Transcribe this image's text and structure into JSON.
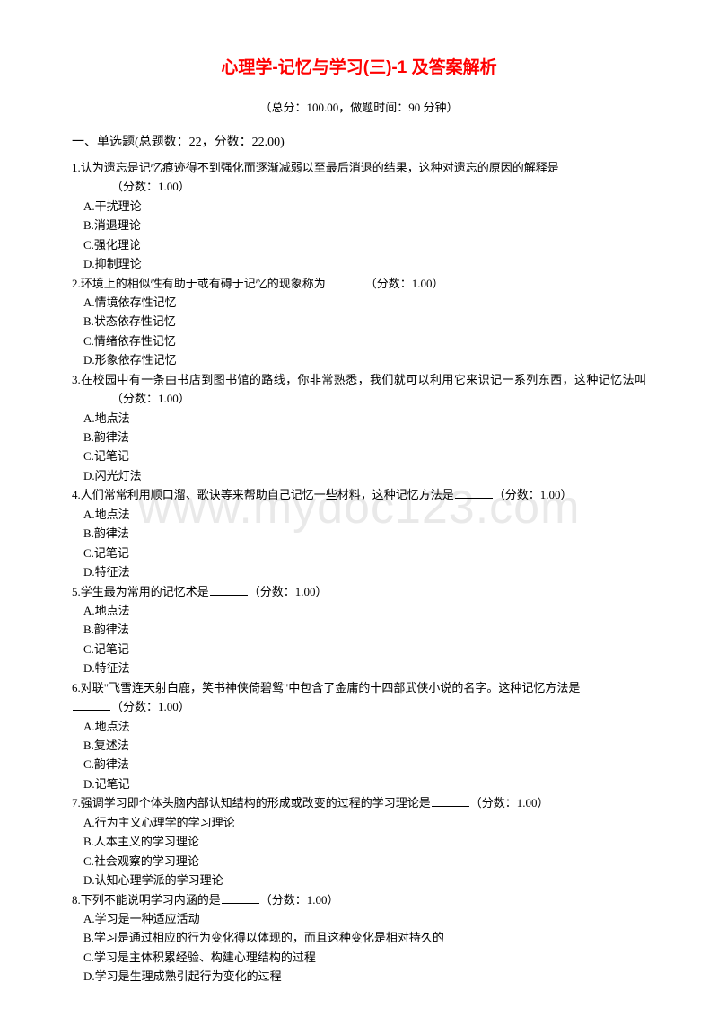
{
  "title": "心理学-记忆与学习(三)-1 及答案解析",
  "meta": "（总分：100.00，做题时间：90 分钟）",
  "section_heading": "一、单选题(总题数：22，分数：22.00)",
  "watermark": "www.mydoc123.com",
  "score_label": "（分数：1.00）",
  "questions": [
    {
      "num": "1.",
      "stem": "认为遗忘是记忆痕迹得不到强化而逐渐减弱以至最后消退的结果，这种对遗忘的原因的解释是",
      "tail_after_blank": true,
      "choices": [
        "A.干扰理论",
        "B.消退理论",
        "C.强化理论",
        "D.抑制理论"
      ]
    },
    {
      "num": "2.",
      "stem": "环境上的相似性有助于或有碍于记忆的现象称为",
      "tail_after_blank": false,
      "choices": [
        "A.情境依存性记忆",
        "B.状态依存性记忆",
        "C.情绪依存性记忆",
        "D.形象依存性记忆"
      ]
    },
    {
      "num": "3.",
      "stem": "在校园中有一条由书店到图书馆的路线，你非常熟悉，我们就可以利用它来识记一系列东西，这种记忆法叫",
      "tail_after_blank": false,
      "choices": [
        "A.地点法",
        "B.韵律法",
        "C.记笔记",
        "D.闪光灯法"
      ]
    },
    {
      "num": "4.",
      "stem": "人们常常利用顺口溜、歌诀等来帮助自己记忆一些材料，这种记忆方法是",
      "tail_after_blank": false,
      "choices": [
        "A.地点法",
        "B.韵律法",
        "C.记笔记",
        "D.特征法"
      ]
    },
    {
      "num": "5.",
      "stem": "学生最为常用的记忆术是",
      "tail_after_blank": false,
      "choices": [
        "A.地点法",
        "B.韵律法",
        "C.记笔记",
        "D.特征法"
      ]
    },
    {
      "num": "6.",
      "stem": "对联\"飞雪连天射白鹿，笑书神侠倚碧鸳\"中包含了金庸的十四部武侠小说的名字。这种记忆方法是",
      "tail_after_blank": true,
      "choices": [
        "A.地点法",
        "B.复述法",
        "C.韵律法",
        "D.记笔记"
      ]
    },
    {
      "num": "7.",
      "stem": "强调学习即个体头脑内部认知结构的形成或改变的过程的学习理论是",
      "tail_after_blank": false,
      "choices": [
        "A.行为主义心理学的学习理论",
        "B.人本主义的学习理论",
        "C.社会观察的学习理论",
        "D.认知心理学派的学习理论"
      ]
    },
    {
      "num": "8.",
      "stem": "下列不能说明学习内涵的是",
      "tail_after_blank": false,
      "choices": [
        "A.学习是一种适应活动",
        "B.学习是通过相应的行为变化得以体现的，而且这种变化是相对持久的",
        "C.学习是主体积累经验、构建心理结构的过程",
        "D.学习是生理成熟引起行为变化的过程"
      ]
    }
  ]
}
